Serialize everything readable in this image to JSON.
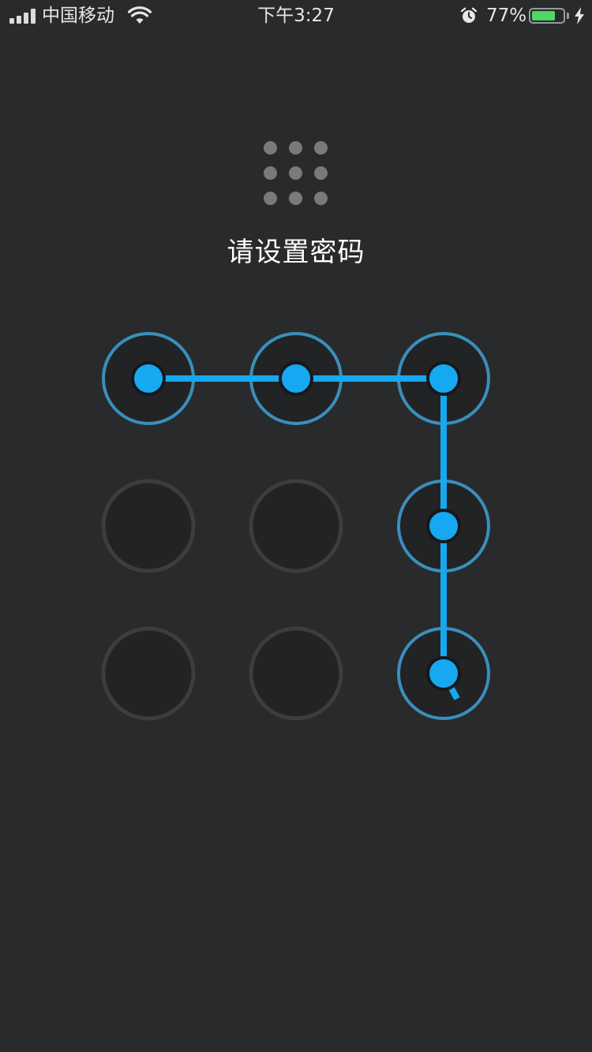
{
  "status_bar": {
    "carrier": "中国移动",
    "time": "下午3:27",
    "battery_percent": "77%",
    "battery_level": 0.77,
    "signal_bars": 4,
    "icons": [
      "signal-icon",
      "wifi-icon",
      "alarm-icon",
      "battery-icon",
      "charging-bolt-icon"
    ],
    "battery_color": "#4cd964"
  },
  "preview": {
    "rows": 3,
    "cols": 3,
    "dot_color": "#7a7a7a"
  },
  "title": "请设置密码",
  "pattern": {
    "rows": 3,
    "cols": 3,
    "selected_sequence": [
      {
        "row": 1,
        "col": 1
      },
      {
        "row": 1,
        "col": 2
      },
      {
        "row": 1,
        "col": 3
      },
      {
        "row": 2,
        "col": 3
      },
      {
        "row": 3,
        "col": 3
      }
    ],
    "colors": {
      "active_ring": "#3a8fbb",
      "active_dot": "#16a8f0",
      "line": "#16a8f0",
      "inactive_ring": "#3c3d3f"
    }
  }
}
